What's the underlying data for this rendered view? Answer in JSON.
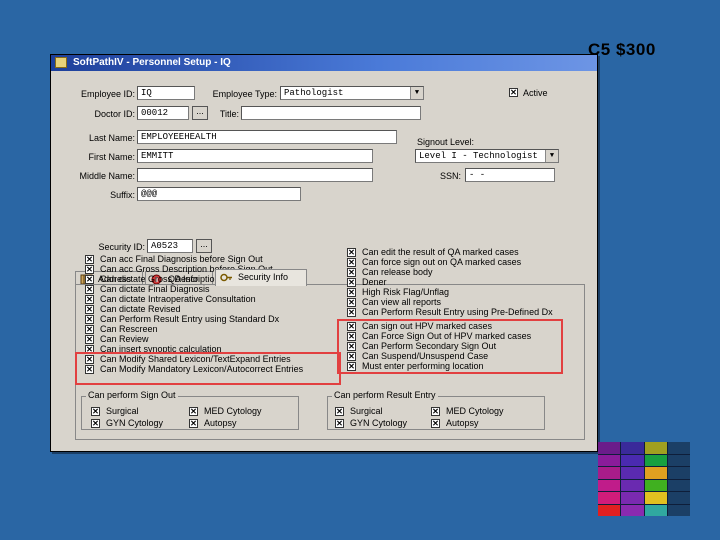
{
  "slide": {
    "label": "C5 $300"
  },
  "window": {
    "title": "SoftPathIV - Personnel Setup - IQ"
  },
  "form": {
    "employee_id_label": "Employee ID:",
    "employee_id": "IQ",
    "employee_type_label": "Employee Type:",
    "employee_type": "Pathologist",
    "active_label": "Active",
    "doctor_id_label": "Doctor ID:",
    "doctor_id": "00012",
    "title_label": "Title:",
    "title_value": "",
    "last_name_label": "Last Name:",
    "last_name": "EMPLOYEEHEALTH",
    "first_name_label": "First Name:",
    "first_name": "EMMITT",
    "middle_name_label": "Middle Name:",
    "middle_name": "",
    "suffix_label": "Suffix:",
    "suffix": "@@@",
    "signout_level_label": "Signout Level:",
    "signout_level": "Level I - Technologist",
    "ssn_label": "SSN:",
    "ssn": "- -",
    "browse_label": "..."
  },
  "tabs": [
    {
      "label": "Address"
    },
    {
      "label": "QA Info"
    },
    {
      "label": "Security Info"
    }
  ],
  "security": {
    "security_id_label": "Security ID:",
    "security_id": "A0523",
    "left_perms": [
      "Can acc Final Diagnosis before Sign Out",
      "Can acc Gross Description before Sign Out",
      "Can dictate Gross Description",
      "Can dictate Final Diagnosis",
      "Can dictate Intraoperative Consultation",
      "Can dictate Revised",
      "Can Perform Result Entry using Standard Dx",
      "Can Rescreen",
      "Can Review",
      "Can insert synoptic calculation",
      "Can Modify Shared Lexicon/TextExpand Entries",
      "Can Modify Mandatory Lexicon/Autocorrect Entries"
    ],
    "right_perms": [
      "Can edit the result of QA marked cases",
      "Can force sign out on QA marked cases",
      "Can release body",
      "Dener",
      "High Risk Flag/Unflag",
      "Can view all reports",
      "Can Perform Result Entry using Pre-Defined Dx",
      "Can sign out HPV marked cases",
      "Can Force Sign Out of HPV marked cases",
      "Can Perform Secondary Sign Out",
      "Can Suspend/Unsuspend Case",
      "Must enter performing location"
    ],
    "signout_group": {
      "title": "Can perform Sign Out",
      "items": [
        "Surgical",
        "MED Cytology",
        "GYN Cytology",
        "Autopsy"
      ]
    },
    "result_group": {
      "title": "Can perform Result Entry",
      "items": [
        "Surgical",
        "MED Cytology",
        "GYN Cytology",
        "Autopsy"
      ]
    }
  },
  "colors": {
    "background": "#2a66a4",
    "highlight_box": "#e24040"
  }
}
